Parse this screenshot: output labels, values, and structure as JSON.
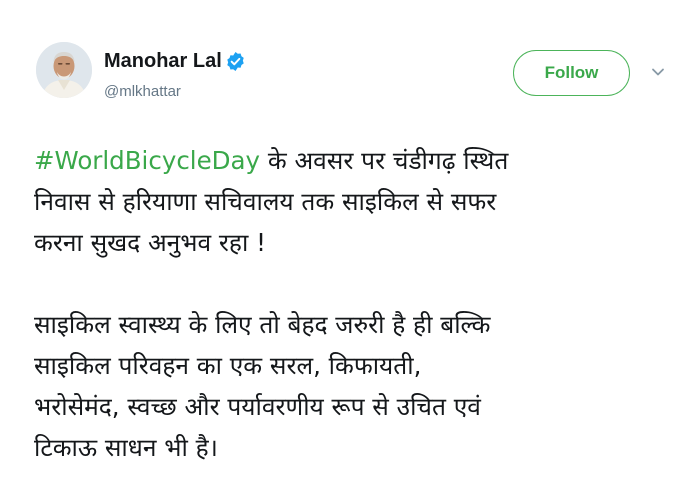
{
  "author": {
    "name": "Manohar Lal",
    "handle": "@mlkhattar",
    "verified": true
  },
  "follow_button": {
    "label": "Follow"
  },
  "colors": {
    "accent": "#3aa84a",
    "text": "#14171a",
    "muted": "#657786",
    "verified_badge": "#1da1f2"
  },
  "icons": {
    "verified": "verified-badge-icon",
    "menu": "chevron-down-icon",
    "avatar": "profile-photo"
  },
  "tweet": {
    "hashtag": "#WorldBicycleDay",
    "para1": {
      "line1_rest": " के अवसर पर चंडीगढ़ स्थित",
      "line2": "निवास से हरियाणा सचिवालय तक साइकिल से सफर",
      "line3": "करना सुखद अनुभव रहा !"
    },
    "para2": {
      "line1": "साइकिल स्वास्थ्य के लिए तो बेहद जरुरी है ही बल्कि",
      "line2": "साइकिल परिवहन का एक सरल, किफायती,",
      "line3": "भरोसेमंद, स्वच्छ और पर्यावरणीय रूप से उचित एवं",
      "line4": "टिकाऊ साधन भी है।"
    }
  }
}
